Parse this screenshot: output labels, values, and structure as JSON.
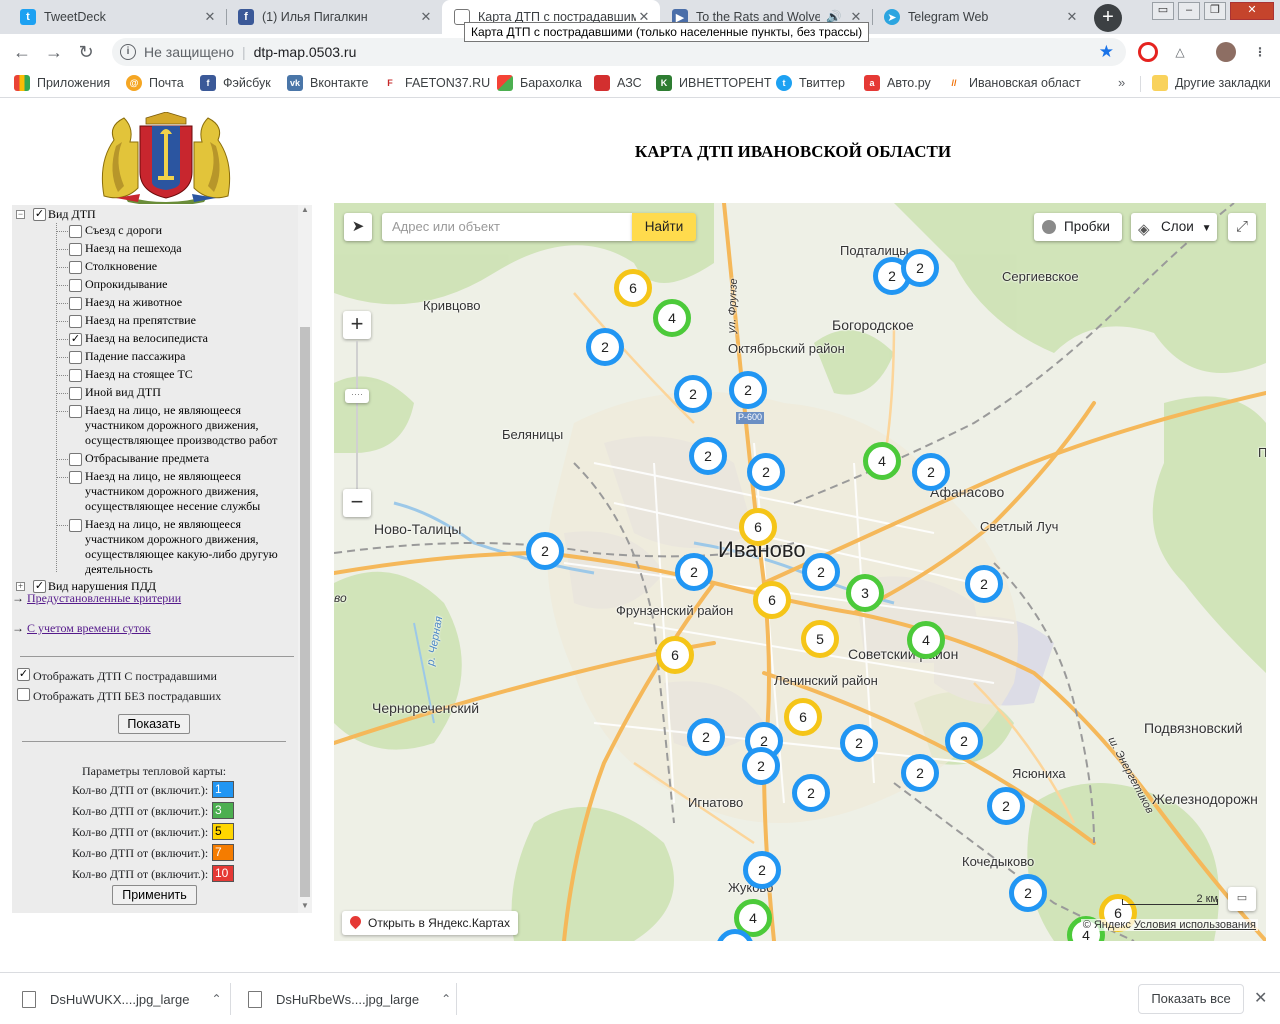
{
  "browser": {
    "tabs": [
      {
        "title": "TweetDeck",
        "icon": "twitter-icon",
        "color": "#1da1f2"
      },
      {
        "title": "(1) Илья Пигалкин",
        "icon": "facebook-icon",
        "color": "#3b5998"
      },
      {
        "title": "Карта ДТП с пострадавшими",
        "icon": "page-icon",
        "color": "#888888"
      },
      {
        "title": "To the Rats and Wolves",
        "icon": "youtube-icon",
        "color": "#4a6ea9"
      },
      {
        "title": "Telegram Web",
        "icon": "telegram-icon",
        "color": "#2ca5e0"
      }
    ],
    "active_tab": 2,
    "tooltip": "Карта ДТП с пострадавшими (только населенные пункты, без трассы)",
    "omnibox": {
      "security": "Не защищено",
      "url": "dtp-map.0503.ru"
    },
    "bookmarks": [
      {
        "label": "Приложения",
        "icon": "apps-grid-icon",
        "color": "#ea4335"
      },
      {
        "label": "Почта",
        "icon": "mail-icon",
        "color": "#f5a623"
      },
      {
        "label": "Фэйсбук",
        "icon": "facebook-icon",
        "color": "#3b5998"
      },
      {
        "label": "Вконтакте",
        "icon": "vk-icon",
        "color": "#4a76a8"
      },
      {
        "label": "FAETON37.RU",
        "icon": "faeton-icon",
        "color": "#c62828"
      },
      {
        "label": "Барахолка",
        "icon": "baraholka-icon",
        "color": "#4caf50"
      },
      {
        "label": "АЗС",
        "icon": "azs-icon",
        "color": "#d32f2f"
      },
      {
        "label": "ИВНЕТТОРЕНТ",
        "icon": "ivnet-icon",
        "color": "#2e7d32"
      },
      {
        "label": "Твиттер",
        "icon": "twitter-icon",
        "color": "#1da1f2"
      },
      {
        "label": "Авто.ру",
        "icon": "autoru-icon",
        "color": "#e53935"
      },
      {
        "label": "Ивановская област",
        "icon": "region-icon",
        "color": "#ef6c00"
      }
    ],
    "bookmarks_more": "»",
    "other_bookmarks": "Другие закладки"
  },
  "page": {
    "title": "КАРТА ДТП ИВАНОВСКОЙ ОБЛАСТИ"
  },
  "filters": {
    "group_label": "Вид ДТП",
    "group_checked": true,
    "items": [
      {
        "lines": [
          "Съезд с дороги"
        ],
        "checked": false
      },
      {
        "lines": [
          "Наезд на пешехода"
        ],
        "checked": false
      },
      {
        "lines": [
          "Столкновение"
        ],
        "checked": false
      },
      {
        "lines": [
          "Опрокидывание"
        ],
        "checked": false
      },
      {
        "lines": [
          "Наезд на животное"
        ],
        "checked": false
      },
      {
        "lines": [
          "Наезд на препятствие"
        ],
        "checked": false
      },
      {
        "lines": [
          "Наезд на велосипедиста"
        ],
        "checked": true
      },
      {
        "lines": [
          "Падение пассажира"
        ],
        "checked": false
      },
      {
        "lines": [
          "Наезд на стоящее ТС"
        ],
        "checked": false
      },
      {
        "lines": [
          "Иной вид ДТП"
        ],
        "checked": false
      },
      {
        "lines": [
          "Наезд на лицо, не являющееся",
          "участником дорожного движения,",
          "осуществляющее производство работ"
        ],
        "checked": false
      },
      {
        "lines": [
          "Отбрасывание предмета"
        ],
        "checked": false
      },
      {
        "lines": [
          "Наезд на лицо, не являющееся",
          "участником дорожного движения,",
          "осуществляющее несение службы"
        ],
        "checked": false
      },
      {
        "lines": [
          "Наезд на лицо, не являющееся",
          "участником дорожного движения,",
          "осуществляющее какую-либо другую",
          "деятельность"
        ],
        "checked": false
      }
    ],
    "group2_label": "Вид нарушения ПДД",
    "group2_checked": true,
    "links": [
      "Предустановленные критерии",
      "С учетом времени суток"
    ],
    "link_arrow": "→",
    "show_with_injured": {
      "label": "Отображать ДТП С пострадавшими",
      "checked": true
    },
    "show_without_injured": {
      "label": "Отображать ДТП БЕЗ пострадавших",
      "checked": false
    },
    "show_button": "Показать",
    "heat": {
      "title": "Параметры тепловой карты:",
      "rows": [
        {
          "label": "Кол-во ДТП от (включит.):",
          "value": "1",
          "color": "#2196f3"
        },
        {
          "label": "Кол-во ДТП от (включит.):",
          "value": "3",
          "color": "#4caf50"
        },
        {
          "label": "Кол-во ДТП от (включит.):",
          "value": "5",
          "color": "#ffd600"
        },
        {
          "label": "Кол-во ДТП от (включит.):",
          "value": "7",
          "color": "#f57c00"
        },
        {
          "label": "Кол-во ДТП от (включит.):",
          "value": "10",
          "color": "#e53935"
        }
      ],
      "apply_button": "Применить"
    }
  },
  "map": {
    "search_placeholder": "Адрес или объект",
    "find_button": "Найти",
    "traffic_button": "Пробки",
    "layers_button": "Слои",
    "scale": "2 км",
    "copyright_brand": "© Яндекс",
    "terms_link": "Условия использования",
    "open_yandex": "Открыть в Яндекс.Картах",
    "city_label": "Иваново",
    "road_shield": "Р-600",
    "clusters": [
      {
        "count": "6",
        "tier": "yellow"
      },
      {
        "count": "4",
        "tier": "green"
      },
      {
        "count": "2",
        "tier": "blue"
      },
      {
        "count": "2",
        "tier": "blue"
      },
      {
        "count": "2",
        "tier": "blue"
      },
      {
        "count": "2",
        "tier": "blue"
      },
      {
        "count": "2",
        "tier": "blue"
      },
      {
        "count": "2",
        "tier": "blue"
      },
      {
        "count": "2",
        "tier": "blue"
      },
      {
        "count": "4",
        "tier": "green"
      },
      {
        "count": "2",
        "tier": "blue"
      },
      {
        "count": "6",
        "tier": "yellow"
      },
      {
        "count": "2",
        "tier": "blue"
      },
      {
        "count": "2",
        "tier": "blue"
      },
      {
        "count": "2",
        "tier": "blue"
      },
      {
        "count": "6",
        "tier": "yellow"
      },
      {
        "count": "3",
        "tier": "green"
      },
      {
        "count": "2",
        "tier": "blue"
      },
      {
        "count": "5",
        "tier": "yellow"
      },
      {
        "count": "4",
        "tier": "green"
      },
      {
        "count": "6",
        "tier": "yellow"
      },
      {
        "count": "6",
        "tier": "yellow"
      },
      {
        "count": "2",
        "tier": "blue"
      },
      {
        "count": "2",
        "tier": "blue"
      },
      {
        "count": "2",
        "tier": "blue"
      },
      {
        "count": "2",
        "tier": "blue"
      },
      {
        "count": "2",
        "tier": "blue"
      },
      {
        "count": "2",
        "tier": "blue"
      },
      {
        "count": "2",
        "tier": "blue"
      },
      {
        "count": "2",
        "tier": "blue"
      },
      {
        "count": "2",
        "tier": "blue"
      },
      {
        "count": "2",
        "tier": "blue"
      },
      {
        "count": "4",
        "tier": "green"
      },
      {
        "count": "2",
        "tier": "blue"
      },
      {
        "count": "6",
        "tier": "yellow"
      },
      {
        "count": "4",
        "tier": "green"
      }
    ],
    "places": [
      "Подталицы",
      "Сергиевское",
      "Кривцово",
      "Богородское",
      "Октябрьский район",
      "Беляницы",
      "Афанасово",
      "Поч",
      "Ново-Талицы",
      "Светлый Луч",
      "Фрунзенский район",
      "Советский район",
      "Ленинский район",
      "Черноречен­ский",
      "Подвязновский",
      "Игнатово",
      "Ясюниха",
      "Железнодорожн",
      "Кочедыково",
      "Жуково",
      "ул. Фрунзе",
      "ш. Энергетиков",
      "р. Черная",
      "во"
    ]
  },
  "downloads": {
    "items": [
      "DsHuWUKX....jpg_large",
      "DsHuRbeWs....jpg_large"
    ],
    "show_all": "Показать все"
  }
}
